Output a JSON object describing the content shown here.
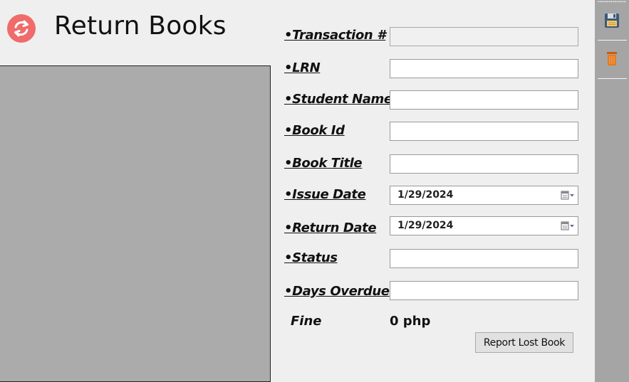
{
  "header": {
    "title": "Return Books",
    "icon": "return-arrows-icon",
    "icon_color": "#f06b6b"
  },
  "form": {
    "transaction_label": "•Transaction #",
    "transaction_value": "",
    "lrn_label": "•LRN",
    "lrn_value": "",
    "student_name_label": "•Student Name",
    "student_name_value": "",
    "book_id_label": "•Book Id",
    "book_id_value": "",
    "book_title_label": "•Book Title",
    "book_title_value": "",
    "issue_date_label": "•Issue Date",
    "issue_date_value": "1/29/2024",
    "return_date_label": "•Return Date",
    "return_date_value": "1/29/2024",
    "status_label": "•Status",
    "status_value": "",
    "days_overdue_label": "•Days Overdue",
    "days_overdue_value": "",
    "fine_label": "Fine",
    "fine_value": "0 php"
  },
  "actions": {
    "report_lost_label": "Report Lost Book"
  },
  "toolbar": {
    "items": [
      {
        "icon": "save-floppy-icon"
      },
      {
        "icon": "delete-trash-icon"
      }
    ],
    "background": "#a5a5a5"
  },
  "colors": {
    "background": "#efefef",
    "preview_panel": "#ababab",
    "accent": "#f06b6b",
    "trash": "#e57a22"
  }
}
